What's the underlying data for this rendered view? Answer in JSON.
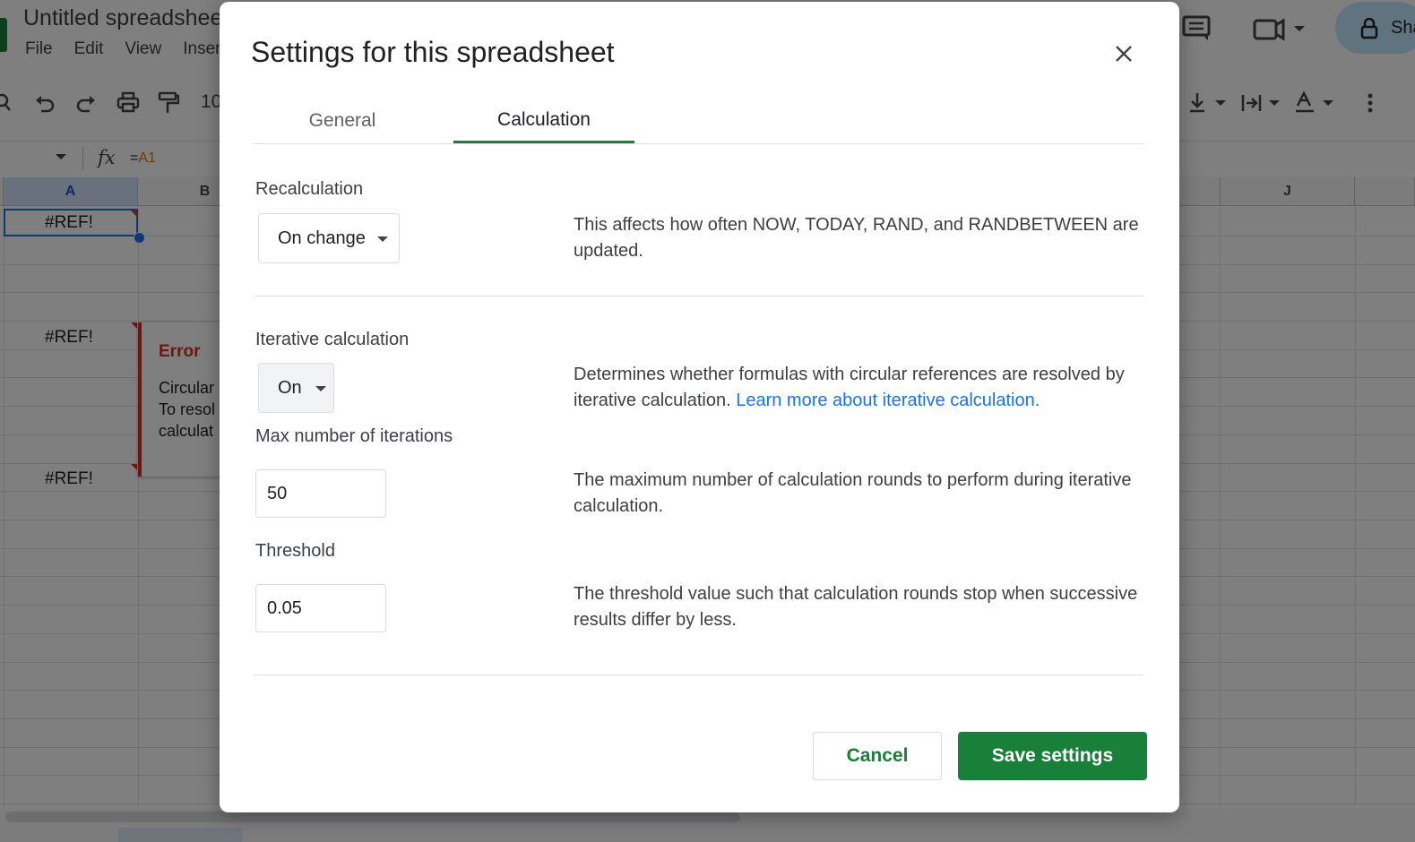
{
  "app": {
    "doc_title": "Untitled spreadsheet",
    "menus": [
      "File",
      "Edit",
      "View",
      "Insert"
    ],
    "font_size_value": "10",
    "name_box_value": "",
    "formula": "=A1",
    "share_label": "Share"
  },
  "sheet": {
    "columns": {
      "a": "A",
      "b": "B",
      "j": "J"
    },
    "cells": {
      "a1": "#REF!",
      "a5": "#REF!",
      "a10": "#REF!"
    },
    "error_popup": {
      "title": "Error",
      "line1": "Circular",
      "line2": "To resol",
      "line3": "calculat"
    }
  },
  "dialog": {
    "title": "Settings for this spreadsheet",
    "tabs": {
      "general": "General",
      "calculation": "Calculation"
    },
    "active_tab": "Calculation",
    "recalculation": {
      "label": "Recalculation",
      "value": "On change",
      "description": "This affects how often NOW, TODAY, RAND, and RANDBETWEEN are updated."
    },
    "iterative": {
      "label": "Iterative calculation",
      "value": "On",
      "description": "Determines whether formulas with circular references are resolved by iterative calculation.",
      "link": "Learn more about iterative calculation."
    },
    "max_iterations": {
      "label": "Max number of iterations",
      "value": "50",
      "description": "The maximum number of calculation rounds to perform during iterative calculation."
    },
    "threshold": {
      "label": "Threshold",
      "value": "0.05",
      "description": "The threshold value such that calculation rounds stop when successive results differ by less."
    },
    "buttons": {
      "cancel": "Cancel",
      "save": "Save settings"
    }
  },
  "colors": {
    "accent": "#188038",
    "link": "#1a73e8",
    "error": "#d93025"
  }
}
